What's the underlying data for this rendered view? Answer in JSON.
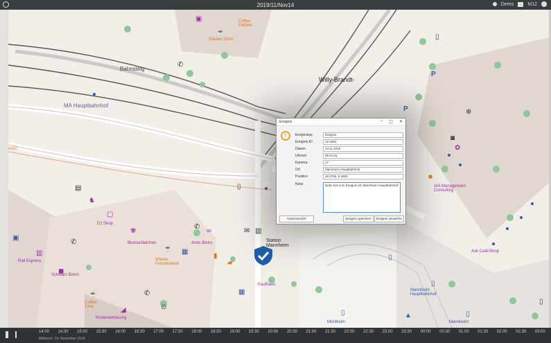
{
  "app": {
    "title": "2019/11/Nov14",
    "user": "Demo",
    "status": "M12"
  },
  "map_labels": {
    "bahnsteig": "Bahnsteig",
    "willy_brandt": "Willy-Brandt-",
    "ma_hbf": "MA Hauptbahnhof",
    "baeckerei": "Bäcker Görtz",
    "cafe_top": "Coffee Fellows",
    "ilis_shop": "DJ Shop",
    "blumen": "Blumenlädchen",
    "amts": "Amts Bistro",
    "wiener": "Wiener Feinbäckerei",
    "kaufhaus": "Kaufhaus",
    "station": "Station Mannheim",
    "mannheim_hbf": "Mannheim Hauptbahnhof",
    "muehlheim": "Mühlheim",
    "mannheim": "Mannheim",
    "ask": "Ask Café/Shop",
    "management": "AIA Management Consulting",
    "rail_express": "Rail Express",
    "schwarz": "Schwarz Bistro",
    "coffee": "Coffee Time",
    "kinder": "Kinderbetreuung",
    "left_stub": "MSC"
  },
  "dialog": {
    "title": "Ereignis",
    "fields": [
      {
        "label": "Ereignistyp",
        "value": "Ereignis"
      },
      {
        "label": "Ereignis-ID",
        "value": "12-4554"
      },
      {
        "label": "Datum",
        "value": "14.11.2019"
      },
      {
        "label": "Uhrzeit",
        "value": "09:41:15"
      },
      {
        "label": "Kamera",
        "value": "17"
      },
      {
        "label": "Ort",
        "value": "Mannheim Hauptbahnhof"
      },
      {
        "label": "Position",
        "value": "49.4795, 8.4693"
      }
    ],
    "notes_label": "Notiz",
    "notes_text": "Notiz text zum Ereignis am Mannheim Hauptbahnhof",
    "btn_left": "Kartenansicht",
    "btn_mid": "Ereignis speichern",
    "btn_right": "Ereignis verwerfen"
  },
  "timeline": {
    "ticks": [
      "14:00",
      "14:30",
      "15:00",
      "15:30",
      "16:00",
      "16:30",
      "17:00",
      "17:30",
      "18:00",
      "18:30",
      "19:00",
      "19:30",
      "20:00",
      "20:30",
      "21:00",
      "21:30",
      "22:00",
      "22:30",
      "23:00",
      "23:30",
      "00:00",
      "00:30",
      "01:00",
      "01:30",
      "02:00",
      "02:30",
      "03:00"
    ],
    "sub": "Mittwoch, 14. November 2019"
  },
  "colors": {
    "topbar": "#3a3d40",
    "timeline": "#2f3236",
    "shield": "#1f5fa8",
    "warn": "#e8a33a",
    "poi_purple": "#9b2fa6",
    "poi_orange": "#e07a1a"
  }
}
